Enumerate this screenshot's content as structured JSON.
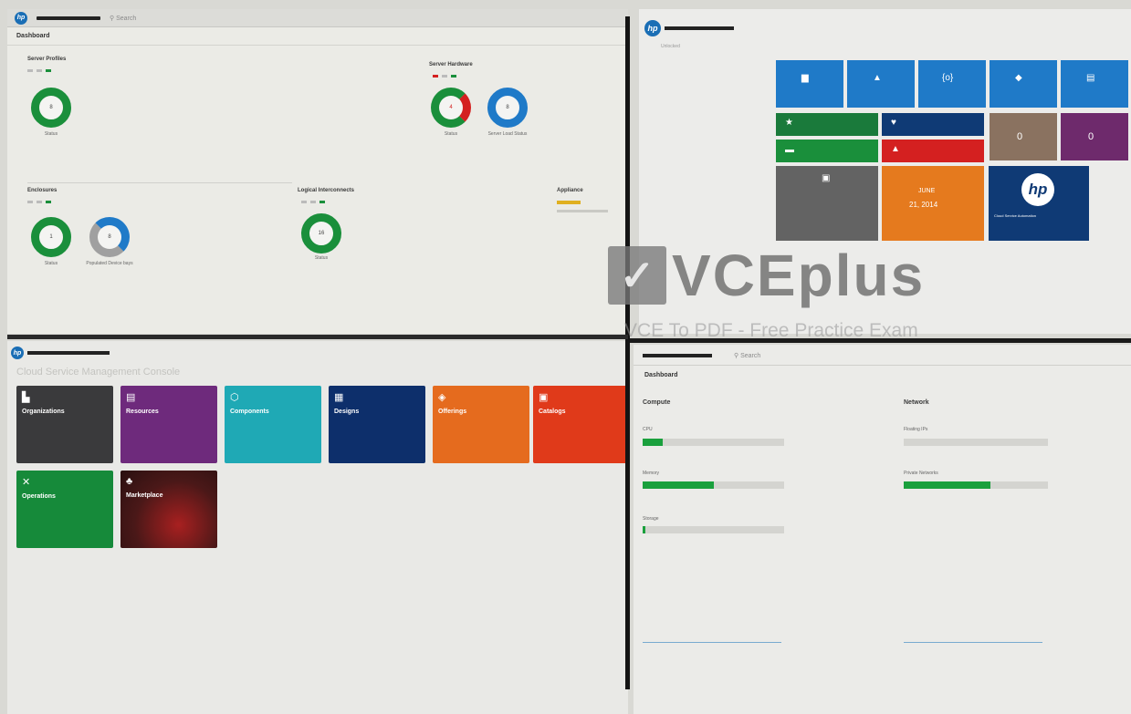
{
  "tl": {
    "search": "Search",
    "header": "Dashboard",
    "sections": [
      {
        "title": "Server Profiles",
        "donuts": [
          {
            "label": "Status"
          }
        ]
      },
      {
        "title": "Server Hardware",
        "donuts": [
          {
            "label": "Status"
          },
          {
            "label": "Server Load Status"
          }
        ]
      },
      {
        "title": "Enclosures",
        "donuts": [
          {
            "label": "Status"
          },
          {
            "label": "Populated Device bays"
          }
        ]
      },
      {
        "title": "Logical Interconnects",
        "donuts": [
          {
            "label": "Status"
          }
        ]
      },
      {
        "title": "Appliance",
        "donuts": []
      }
    ]
  },
  "tr": {
    "subtitle": "Unlocked",
    "value_tiles": [
      "0",
      "0"
    ],
    "date_tile": {
      "line1": "JUNE",
      "line2": "21, 2014"
    },
    "hp_tile_label": "Cloud Service Automation"
  },
  "watermark": {
    "main": "VCEplus",
    "sub": "VCE To PDF - Free Practice Exam"
  },
  "bl": {
    "title": "Cloud Service Management Console",
    "cards": [
      {
        "title": "Organizations",
        "color": "#3a3a3c",
        "icon": "building-icon"
      },
      {
        "title": "Resources",
        "color": "#6e2a7c",
        "icon": "resources-icon"
      },
      {
        "title": "Components",
        "color": "#1fa9b5",
        "icon": "components-icon"
      },
      {
        "title": "Designs",
        "color": "#0d2f6b",
        "icon": "designs-icon"
      },
      {
        "title": "Offerings",
        "color": "#e56b1e",
        "icon": "offerings-icon"
      },
      {
        "title": "Catalogs",
        "color": "#e03a1a",
        "icon": "catalogs-icon"
      },
      {
        "title": "Operations",
        "color": "#168a3a",
        "icon": "operations-icon"
      },
      {
        "title": "Marketplace",
        "color": "#4a1818",
        "icon": "marketplace-icon"
      }
    ]
  },
  "br": {
    "search": "Search",
    "header": "Dashboard",
    "compute": {
      "title": "Compute",
      "bars": [
        {
          "label": "CPU",
          "fill": 0.14
        },
        {
          "label": "Memory",
          "fill": 0.5
        },
        {
          "label": "Storage",
          "fill": 0.02
        }
      ]
    },
    "network": {
      "title": "Network",
      "bars": [
        {
          "label": "Floating IPs",
          "fill": 0.0
        },
        {
          "label": "Private Networks",
          "fill": 0.6
        }
      ]
    }
  },
  "colors": {
    "green": "#1a8f3b",
    "blue": "#1f7ac8",
    "red": "#d42020",
    "navy": "#0f3a75"
  }
}
